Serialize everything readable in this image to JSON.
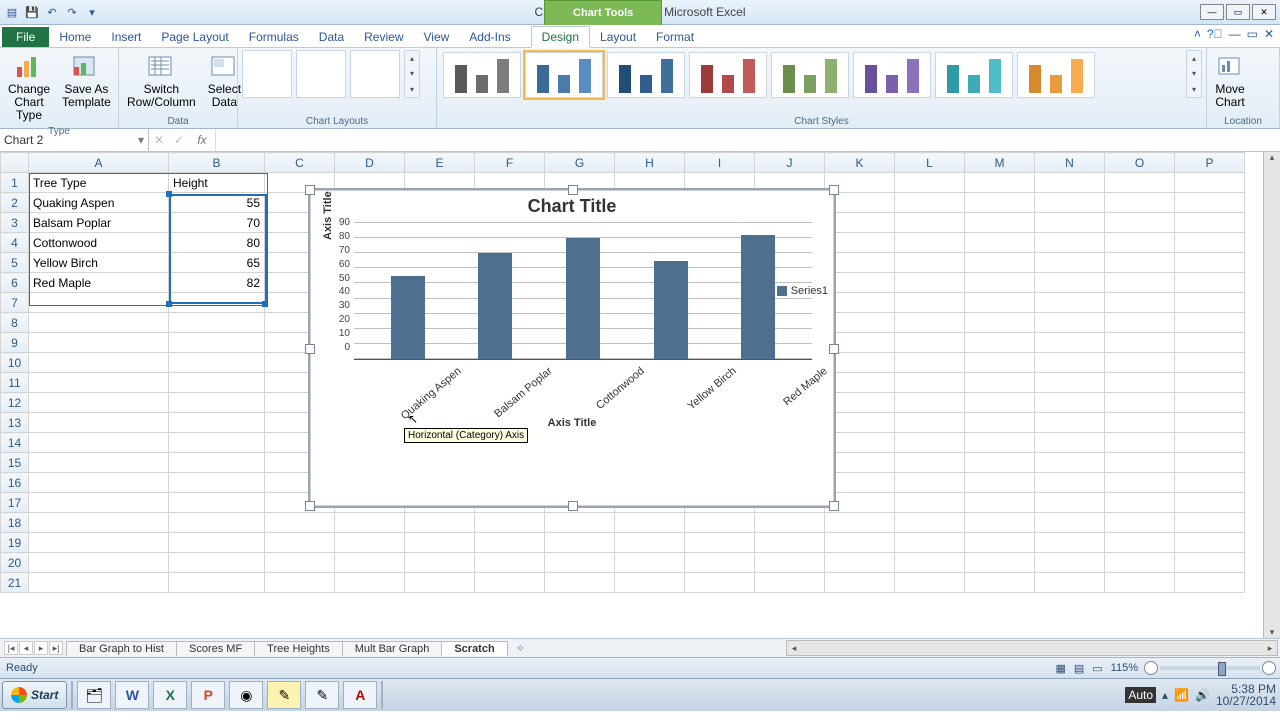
{
  "app": {
    "titlebar": "Chap 3 Web Tech.xlsx - Microsoft Excel",
    "chart_tools": "Chart Tools"
  },
  "tabs": {
    "file": "File",
    "home": "Home",
    "insert": "Insert",
    "pagelayout": "Page Layout",
    "formulas": "Formulas",
    "data": "Data",
    "review": "Review",
    "view": "View",
    "addins": "Add-Ins",
    "design": "Design",
    "layout": "Layout",
    "format": "Format"
  },
  "ribbon": {
    "change_chart_type": "Change\nChart Type",
    "save_as_template": "Save As\nTemplate",
    "switch_row_col": "Switch\nRow/Column",
    "select_data": "Select\nData",
    "move_chart": "Move\nChart",
    "group_type": "Type",
    "group_data": "Data",
    "group_layouts": "Chart Layouts",
    "group_styles": "Chart Styles",
    "group_location": "Location"
  },
  "namebox": "Chart 2",
  "fx": "fx",
  "columns": [
    "A",
    "B",
    "C",
    "D",
    "E",
    "F",
    "G",
    "H",
    "I",
    "J",
    "K",
    "L",
    "M",
    "N",
    "O",
    "P"
  ],
  "rows": 21,
  "table": {
    "header": [
      "Tree Type",
      "Height"
    ],
    "rows": [
      [
        "Quaking Aspen",
        "55"
      ],
      [
        "Balsam Poplar",
        "70"
      ],
      [
        "Cottonwood",
        "80"
      ],
      [
        "Yellow Birch",
        "65"
      ],
      [
        "Red Maple",
        "82"
      ]
    ]
  },
  "chart": {
    "title": "Chart Title",
    "yaxis_title": "Axis Title",
    "xaxis_title": "Axis Title",
    "legend": "Series1",
    "tooltip": "Horizontal (Category) Axis"
  },
  "chart_data": {
    "type": "bar",
    "categories": [
      "Quaking Aspen",
      "Balsam Poplar",
      "Cottonwood",
      "Yellow Birch",
      "Red Maple"
    ],
    "values": [
      55,
      70,
      80,
      65,
      82
    ],
    "title": "Chart Title",
    "xlabel": "Axis Title",
    "ylabel": "Axis Title",
    "ylim": [
      0,
      90
    ],
    "yticks": [
      0,
      10,
      20,
      30,
      40,
      50,
      60,
      70,
      80,
      90
    ],
    "series_name": "Series1"
  },
  "sheets": {
    "tabs": [
      "Bar Graph to Hist",
      "Scores MF",
      "Tree Heights",
      "Mult Bar Graph",
      "Scratch"
    ],
    "active": "Scratch"
  },
  "status": {
    "ready": "Ready",
    "zoom": "115%"
  },
  "taskbar": {
    "start": "Start",
    "time": "5:38 PM",
    "date": "10/27/2014",
    "auto": "Auto"
  },
  "style_colors": [
    [
      "#5a5a5a",
      "#6c6c6c",
      "#7d7d7d"
    ],
    [
      "#3b6a99",
      "#4b7bad",
      "#5a8cc0"
    ],
    [
      "#1f4e79",
      "#2f5f8a",
      "#3f709b"
    ],
    [
      "#9d3a3a",
      "#b04a4a",
      "#c35a5a"
    ],
    [
      "#6b8e4e",
      "#7c9f5f",
      "#8db070"
    ],
    [
      "#6a4f9b",
      "#7b60ac",
      "#8c71bd"
    ],
    [
      "#2e9aa6",
      "#3fabb7",
      "#50bcc8"
    ],
    [
      "#d68a2d",
      "#e79b3e",
      "#f8ac4f"
    ]
  ]
}
